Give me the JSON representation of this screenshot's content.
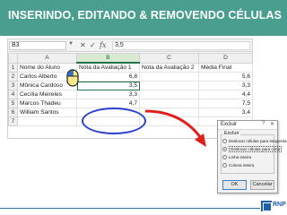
{
  "header": {
    "title": "INSERINDO, EDITANDO & REMOVENDO CÉLULAS",
    "color": "#4a9e8f"
  },
  "formula_bar": {
    "cell_ref": "B3",
    "dropdown_icon": "chevron-down-icon",
    "cancel_icon": "✕",
    "confirm_icon": "✓",
    "fx_label": "fx",
    "value": "3,5"
  },
  "spreadsheet": {
    "col_headers": [
      "A",
      "B",
      "C",
      "D"
    ],
    "selected_column": "B",
    "rows": [
      {
        "n": "1",
        "cells": [
          "Nome do Aluno",
          "Nota da Avaliação 1",
          "Nota da Avaliação 2",
          "Média Final"
        ]
      },
      {
        "n": "2",
        "cells": [
          "Carlos Alberto",
          "6,8",
          "",
          "5,6"
        ]
      },
      {
        "n": "3",
        "cells": [
          "Mônica Cardoso",
          "3,5",
          "",
          "3,3"
        ]
      },
      {
        "n": "4",
        "cells": [
          "Cecília Meireles",
          "3,3",
          "",
          "4,4"
        ]
      },
      {
        "n": "5",
        "cells": [
          "Marcos Thadeu",
          "4,7",
          "",
          "7,5"
        ]
      },
      {
        "n": "6",
        "cells": [
          "William Santos",
          "",
          "",
          "3,4"
        ]
      },
      {
        "n": "7",
        "cells": [
          "",
          "",
          "",
          ""
        ]
      }
    ]
  },
  "annotations": {
    "highlight_color": "#2a3fd1",
    "arrow_color": "#e0201c"
  },
  "dialog": {
    "title": "Excluir",
    "help": "?",
    "close": "✕",
    "group_label": "Excluir",
    "options": [
      "Deslocar células para esquerda",
      "Deslocar células para cima",
      "Linha inteira",
      "Coluna inteira"
    ],
    "selected_option": 1,
    "ok_label": "OK",
    "cancel_label": "Cancelar"
  },
  "footer": {
    "logo_text": "RNP",
    "line_color": "#2d6ba8"
  }
}
